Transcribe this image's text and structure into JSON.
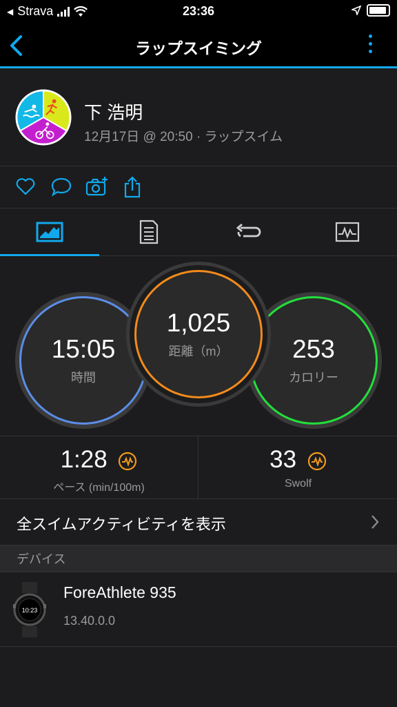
{
  "status_bar": {
    "back_app": "Strava",
    "time": "23:36"
  },
  "nav": {
    "title": "ラップスイミング"
  },
  "profile": {
    "name": "下 浩明",
    "subtitle": "12月17日 @ 20:50 · ラップスイム"
  },
  "metrics": {
    "time": {
      "value": "15:05",
      "label": "時間"
    },
    "distance": {
      "value": "1,025",
      "label": "距離（m）"
    },
    "calories": {
      "value": "253",
      "label": "カロリー"
    }
  },
  "stats": {
    "pace": {
      "value": "1:28",
      "label": "ペース (min/100m)"
    },
    "swolf": {
      "value": "33",
      "label": "Swolf"
    }
  },
  "all_swim": {
    "label": "全スイムアクティビティを表示"
  },
  "devices_section": {
    "label": "デバイス"
  },
  "device": {
    "name": "ForeAthlete 935",
    "version": "13.40.0.0",
    "watch_face_time": "10:23"
  },
  "colors": {
    "accent": "#11a9ed",
    "time_ring": "#5b8de8",
    "distance_ring": "#f28b1b",
    "calories_ring": "#22e03a",
    "trend_icon": "#f29a1b"
  },
  "icons": {
    "actions": [
      "heart-icon",
      "comment-icon",
      "camera-add-icon",
      "share-icon"
    ],
    "tabs": [
      "overview-icon",
      "details-icon",
      "laps-icon",
      "chart-icon"
    ]
  }
}
